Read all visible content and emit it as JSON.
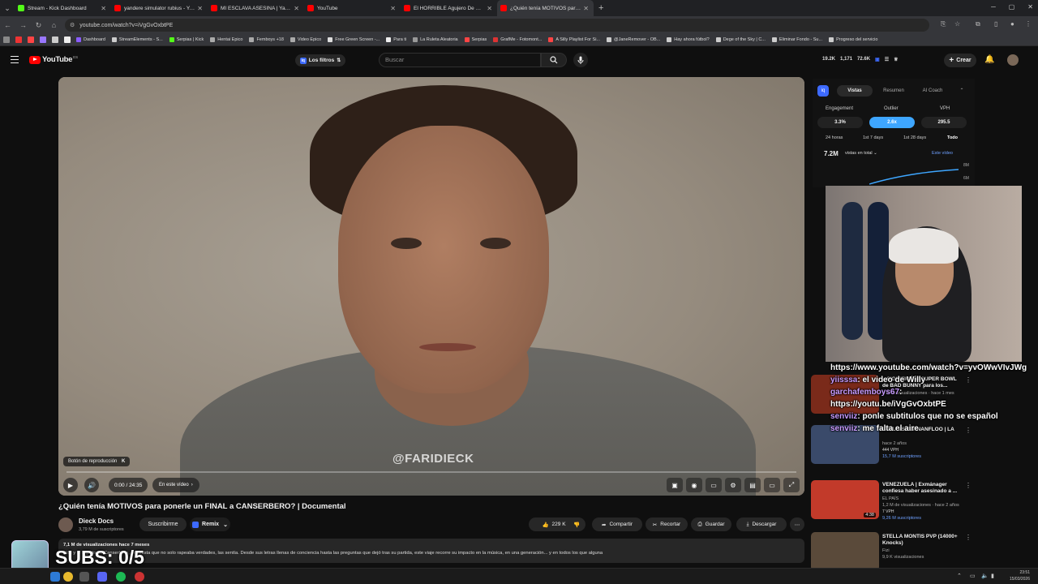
{
  "tabs": [
    {
      "title": "Stream - Kick Dashboard",
      "color": "#53fc18"
    },
    {
      "title": "yandere simulator rubius - YouTube",
      "color": "#ff0000"
    },
    {
      "title": "MI ESCLAVA ASESINA | Yandere",
      "color": "#ff0000"
    },
    {
      "title": "YouTube",
      "color": "#ff0000"
    },
    {
      "title": "El HORRIBLE Agujero De Conejo",
      "color": "#ff0000"
    },
    {
      "title": "¿Quién tenía MOTIVOS para pon",
      "color": "#ff0000",
      "active": true
    }
  ],
  "address": {
    "url": "youtube.com/watch?v=iVgGvOxbtPE"
  },
  "bookmarks": [
    "Dashboard",
    "StreamElements - S...",
    "Serpias | Kick",
    "Hentai Epico",
    "Femboys +18",
    "Video Epico",
    "Free Green Screen -...",
    "Para ti",
    "La Ruleta Aleatoria",
    "Serpias",
    "GrafMe - Fotomont...",
    "A Silly Playlist For Si...",
    "@JaneRemover - OB...",
    "Hay ahora fútbol?",
    "Dege of the Sky | C...",
    "Eliminar Fondo - Su...",
    "Progreso del servicio"
  ],
  "header": {
    "logo_text": "YouTube",
    "logo_country": "ES",
    "filters_label": "Los filtros",
    "search_placeholder": "Buscar",
    "stats": [
      "19.2K",
      "1,171",
      "72.6K"
    ],
    "create_label": "Crear"
  },
  "player": {
    "watermark": "@FARIDIECK",
    "playback_badge": "Botón de reproducción",
    "time": "0:00 / 24:35",
    "chapter": "En este vídeo",
    "progress_fraction": 0.0
  },
  "video": {
    "title": "¿Quién tenía MOTIVOS para ponerle un FINAL a CANSERBERO? | Documental",
    "channel": "Dieck Docs",
    "subscribers": "3,79 M de suscriptores",
    "subscribe_label": "Suscribirme",
    "remix_label": "Remix",
    "likes": "229 K",
    "share_label": "Compartir",
    "clip_label": "Recortar",
    "save_label": "Guardar",
    "download_label": "Descargar",
    "desc_meta": "7,1 M de visualizaciones  hace 7 meses",
    "desc_body": "vida y el legado de Canserbero, un artista que no solo rapeaba verdades, las sentía. Desde sus letras llenas de conciencia hasta las preguntas que dejó tras su partida, este viaje recorre su impacto en la música, en una generación... y en todos los que alguna"
  },
  "overlay": {
    "subs": "SUBS: 0/5"
  },
  "sidepanel": {
    "tabs": [
      "Vistas",
      "Resumen",
      "AI Coach"
    ],
    "metrics": [
      {
        "label": "Engagement",
        "value": "3.3%"
      },
      {
        "label": "Outlier",
        "value": "2.6x"
      },
      {
        "label": "VPH",
        "value": "295.5"
      }
    ],
    "periods": [
      "24 horas",
      "1st 7 days",
      "1st 28 days",
      "Todo"
    ],
    "total_views": "7.2M",
    "total_label": "vistas en total",
    "legend": "Este vídeo",
    "axis": [
      "8M",
      "6M"
    ]
  },
  "chat": [
    {
      "user": "",
      "text": "https://www.youtube.com/watch?v=yvOWwVIvJWg"
    },
    {
      "user": "yiisssa",
      "text": ": el video de Willy"
    },
    {
      "user": "garchafemboys67",
      "text": ":"
    },
    {
      "user": "",
      "text": "https://youtu.be/iVgGvOxbtPE"
    },
    {
      "user": "senviiz",
      "text": ": ponle subtitulos que no se español"
    },
    {
      "user": "senviiz",
      "text": ": me falta el aire"
    }
  ],
  "related": [
    {
      "title": "...SIGNIFICÓ el SUPER BOWL de BAD BUNNY para los...",
      "meta": "5 M de visualizaciones · hace 1 mes",
      "color": "#7a2a1a"
    },
    {
      "title": "LUZU VS FERNANFLOO | LA",
      "meta": "hace 2 años",
      "vph": "444 VPH",
      "subs": "15,7 M suscriptores",
      "color": "#3a4a6a"
    },
    {
      "title": "VENEZUELA | Exmánager confiesa haber asesinado a ...",
      "channel": "EL PAÍS",
      "meta": "1,2 M de visualizaciones · hace 2 años",
      "vph": "7 VPH",
      "subs": "9,26 M suscriptores",
      "duration": "4:38",
      "color": "#c23a2a"
    },
    {
      "title": "STELLA MONTIS PVP (14000+ Knocks)",
      "channel": "Fizi",
      "meta": "9,9 K visualizaciones",
      "color": "#5a4a3a"
    }
  ],
  "taskbar": {
    "time": "23:51",
    "date": "15/03/2026"
  }
}
